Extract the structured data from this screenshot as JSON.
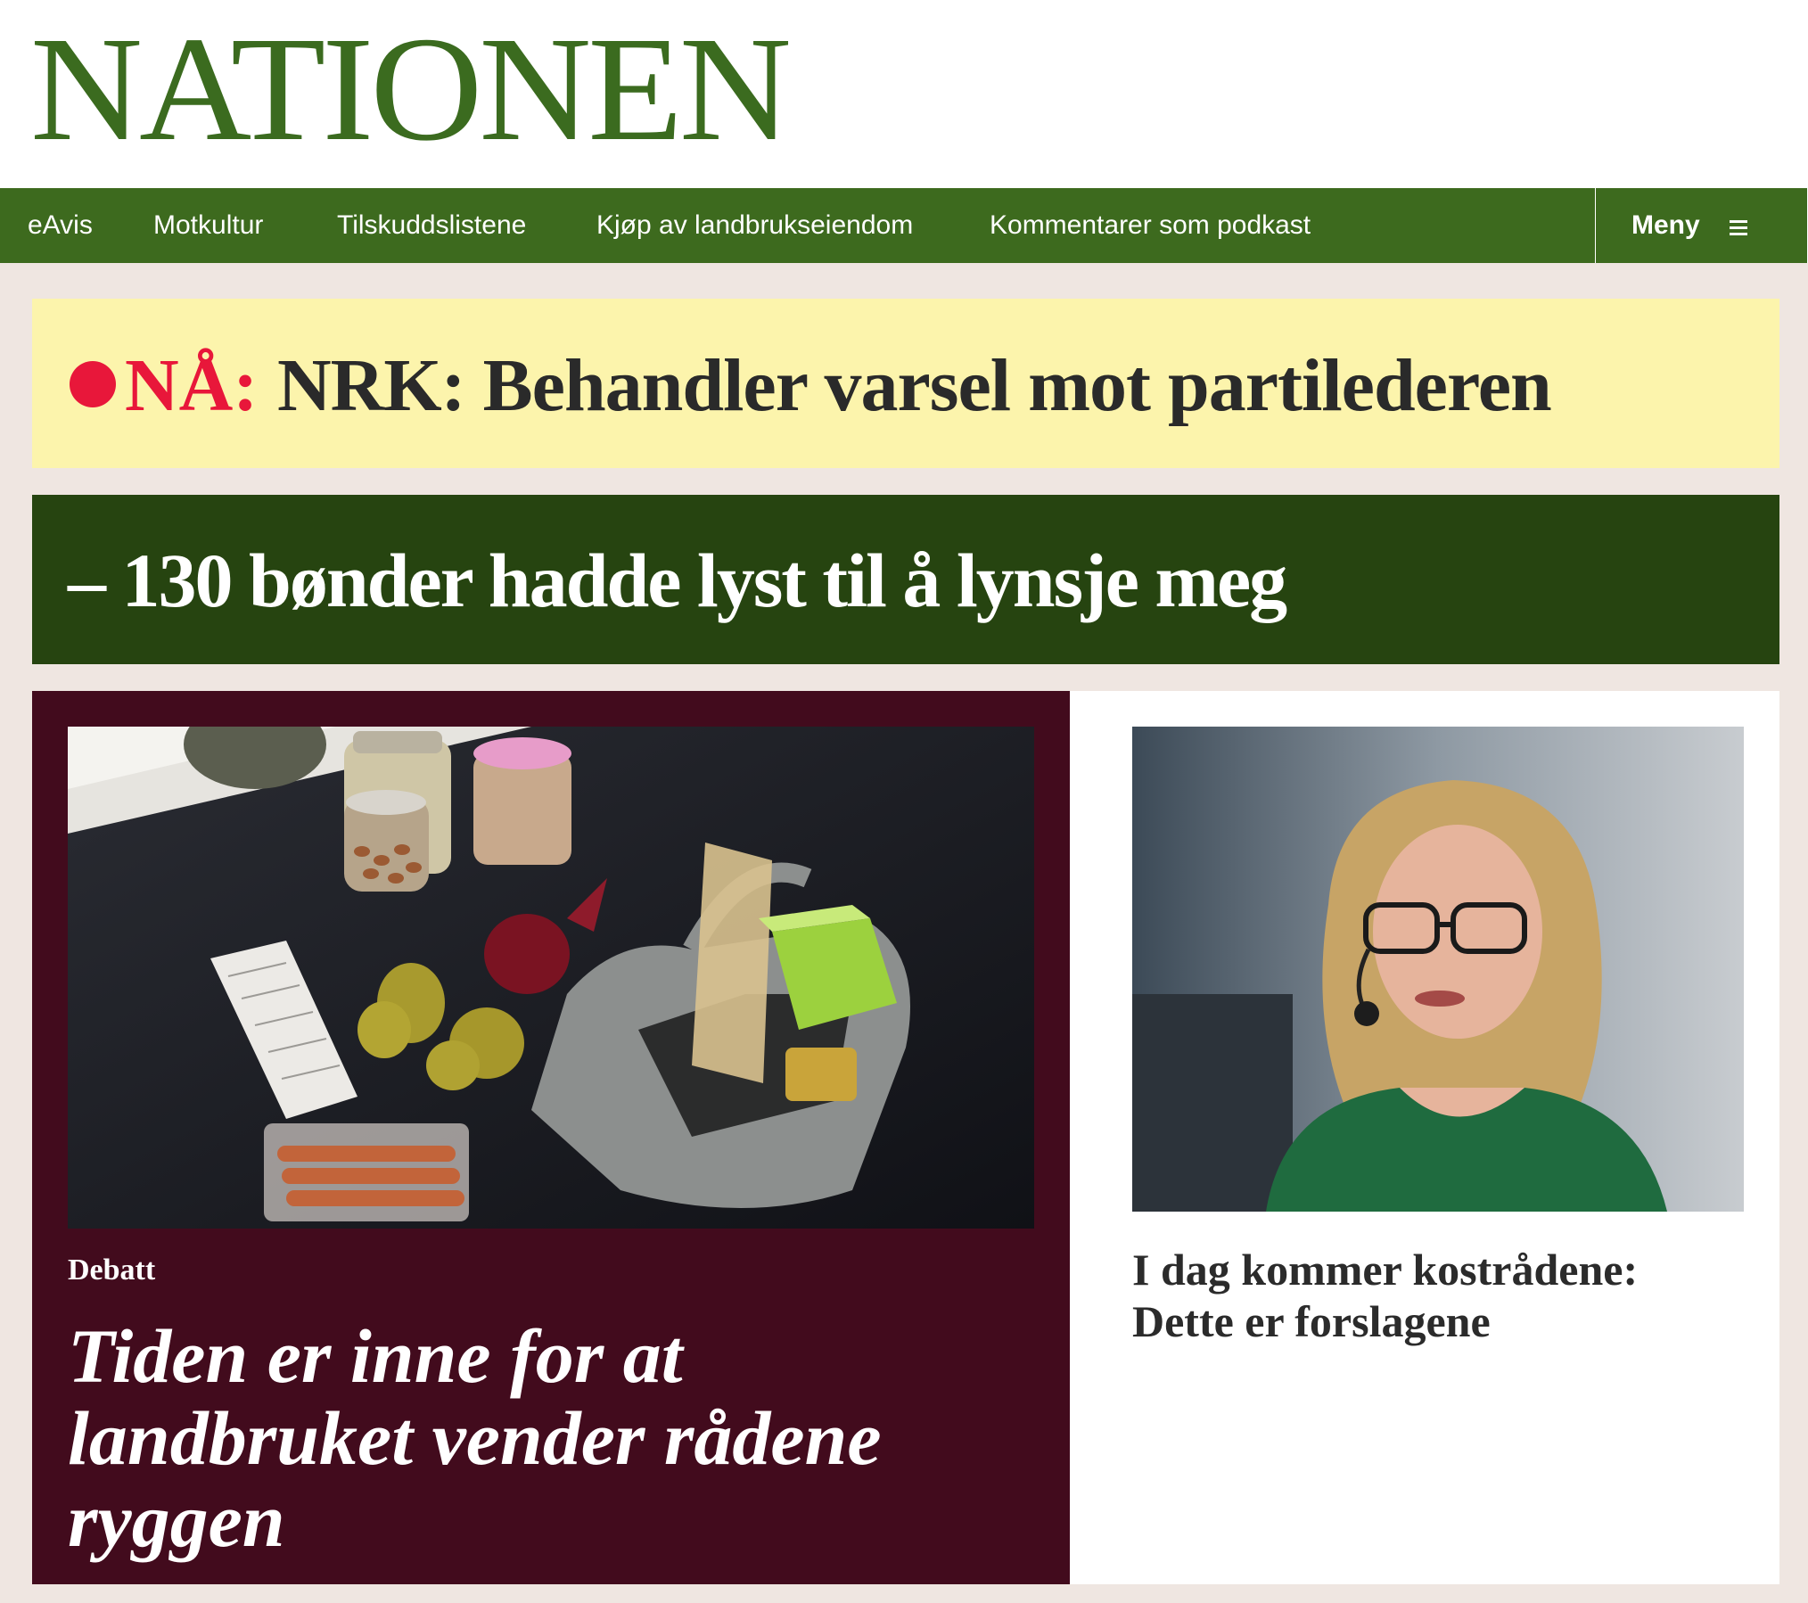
{
  "site": {
    "logo_text": "NATIONEN"
  },
  "nav": {
    "items": [
      {
        "label": "eAvis"
      },
      {
        "label": "Motkultur"
      },
      {
        "label": "Tilskuddslistene"
      },
      {
        "label": "Kjøp av landbrukseiendom"
      },
      {
        "label": "Kommentarer som podkast"
      }
    ],
    "menu_label": "Meny"
  },
  "breaking": {
    "tag": "NÅ:",
    "headline": "NRK: Behandler varsel mot partilederen"
  },
  "feature": {
    "headline": "– 130 bønder hadde lyst til å lynsje meg"
  },
  "articles": [
    {
      "kicker": "Debatt",
      "title": "Tiden er inne for at landbruket vender rådene ryggen",
      "image": "groceries-on-countertop"
    },
    {
      "title": "I dag kommer kostrådene: Dette er forslagene",
      "image": "woman-with-headset-microphone"
    }
  ],
  "colors": {
    "brand_green": "#3b6b1f",
    "nav_green": "#3d6a1e",
    "breaking_bg": "#fcf4ac",
    "breaking_red": "#e8173a",
    "feature_bg": "#264410",
    "debate_bg": "#420b1d",
    "page_bg": "#efe6e1"
  }
}
